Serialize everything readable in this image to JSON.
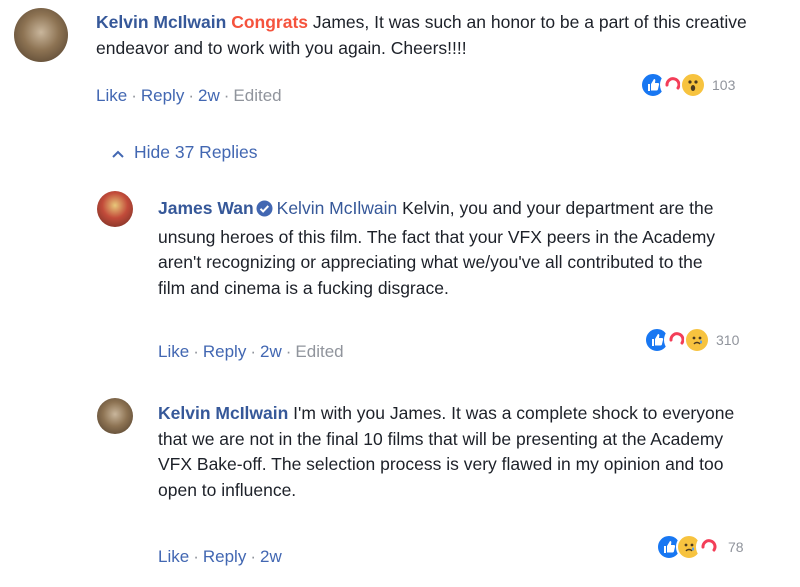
{
  "comments": [
    {
      "author": "Kelvin McIlwain",
      "highlight": "Congrats",
      "text": " James, It was such an honor to be a part of this creative endeavor and to work with you again. Cheers!!!!",
      "actions": {
        "like": "Like",
        "reply": "Reply",
        "time": "2w",
        "edited": "Edited"
      },
      "reactions": {
        "types": [
          "like-icon",
          "love-icon",
          "wow-icon"
        ],
        "count": "103"
      }
    },
    {
      "author": "James Wan",
      "verified": true,
      "mention": "Kelvin McIlwain",
      "text": " Kelvin, you and your department are the unsung heroes of this film. The fact that your VFX peers in the Academy aren't recognizing or appreciating what we/you've all contributed to the film and cinema is a fucking disgrace.",
      "actions": {
        "like": "Like",
        "reply": "Reply",
        "time": "2w",
        "edited": "Edited"
      },
      "reactions": {
        "types": [
          "like-icon",
          "love-icon",
          "sad-icon"
        ],
        "count": "310"
      }
    },
    {
      "author": "Kelvin McIlwain",
      "text": " I'm with you James. It was a complete shock to everyone that we are not in the final 10 films that will be presenting at the Academy VFX Bake-off. The selection process is very flawed in my opinion and too open to influence.",
      "actions": {
        "like": "Like",
        "reply": "Reply",
        "time": "2w"
      },
      "reactions": {
        "types": [
          "like-icon",
          "sad-icon",
          "love-icon"
        ],
        "count": "78"
      }
    }
  ],
  "replies_toggle": "Hide 37 Replies",
  "separator": "·",
  "colors": {
    "link": "#4267b2",
    "author": "#365899",
    "highlight": "#f5533d",
    "meta": "#90949c"
  }
}
